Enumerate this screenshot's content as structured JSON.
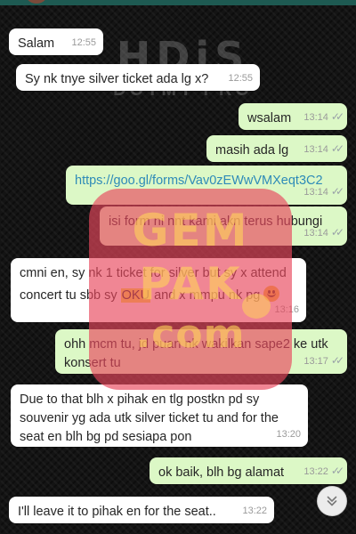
{
  "wallpaper": {
    "logo_big": "HDiS",
    "logo_small": "DOTMY PRO"
  },
  "watermark": {
    "line1": "GEM",
    "line2": "PAK",
    "line3": ".com"
  },
  "messages": [
    {
      "dir": "in",
      "text": "Salam",
      "time": "12:55"
    },
    {
      "dir": "in",
      "text": "Sy nk tnye silver ticket ada lg x?",
      "time": "12:55"
    },
    {
      "dir": "out",
      "text": "wsalam",
      "time": "13:14",
      "ticks": "✓✓"
    },
    {
      "dir": "out",
      "text": "masih ada lg",
      "time": "13:14",
      "ticks": "✓✓"
    },
    {
      "dir": "out",
      "text": "https://goo.gl/forms/Vav0zEWwVMXeqt3C2",
      "time": "13:14",
      "ticks": "✓✓"
    },
    {
      "dir": "out",
      "text": "isi form ni nnt kami akn terus hubungi",
      "time": "13:14",
      "ticks": "✓✓"
    },
    {
      "dir": "in",
      "text_before": "cmni en, sy nk 1 ticket for silver but sy x attend concert tu sbb sy ",
      "highlight": "OKU",
      "text_after": " and x mmpu nk pg",
      "emoji": "smiling-face-emoji",
      "time": "13:16"
    },
    {
      "dir": "out",
      "text": "ohh mcm tu, jd puan nk wakilkan sape2 ke utk konsert tu",
      "time": "13:17",
      "ticks": "✓✓"
    },
    {
      "dir": "in",
      "text": "Due to that blh x pihak en tlg postkn pd sy souvenir yg ada utk silver ticket tu and for the seat en blh bg pd sesiapa pon",
      "time": "13:20"
    },
    {
      "dir": "out",
      "text": "ok baik, blh bg alamat",
      "time": "13:22",
      "ticks": "✓✓"
    },
    {
      "dir": "in",
      "text": "I'll leave it to pihak en for the seat..",
      "time": "13:22"
    }
  ],
  "scroll_button": {
    "icon": "double-chevron-down-icon"
  }
}
